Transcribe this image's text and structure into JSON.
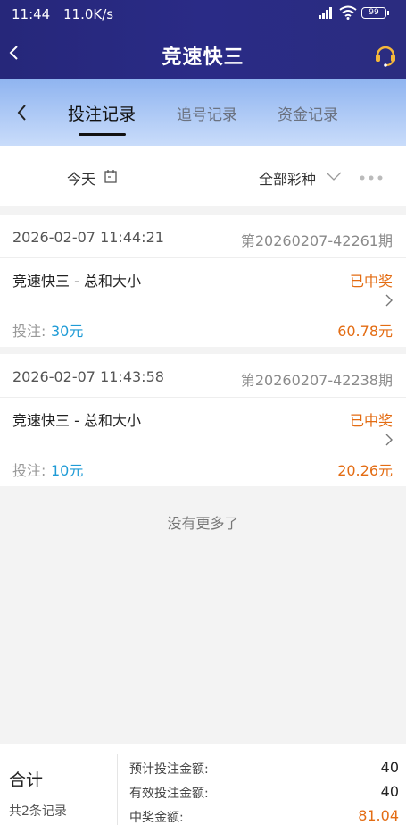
{
  "status_bar": {
    "time": "11:44",
    "network_speed": "11.0K/s",
    "battery": "99"
  },
  "header": {
    "title": "竞速快三"
  },
  "tabs": [
    {
      "label": "投注记录",
      "active": true
    },
    {
      "label": "追号记录",
      "active": false
    },
    {
      "label": "资金记录",
      "active": false
    }
  ],
  "filter": {
    "date_label": "今天",
    "lottery_label": "全部彩种"
  },
  "records": [
    {
      "time": "2026-02-07 11:44:21",
      "issue": "第20260207-42261期",
      "game": "竞速快三 - 总和大小",
      "status": "已中奖",
      "bet_label": "投注:",
      "bet_amount": "30元",
      "win_amount": "60.78元"
    },
    {
      "time": "2026-02-07 11:43:58",
      "issue": "第20260207-42238期",
      "game": "竞速快三 - 总和大小",
      "status": "已中奖",
      "bet_label": "投注:",
      "bet_amount": "10元",
      "win_amount": "20.26元"
    }
  ],
  "no_more": "没有更多了",
  "summary": {
    "title": "合计",
    "count": "共2条记录",
    "expected_bet_label": "预计投注金额:",
    "expected_bet_value": "40",
    "valid_bet_label": "有效投注金额:",
    "valid_bet_value": "40",
    "win_label": "中奖金额:",
    "win_value": "81.04"
  },
  "colors": {
    "header_bg": "#2a2b86",
    "tab_gradient_top": "#8fb4f0",
    "accent_orange": "#e36c13",
    "accent_blue": "#1f9bd6"
  }
}
